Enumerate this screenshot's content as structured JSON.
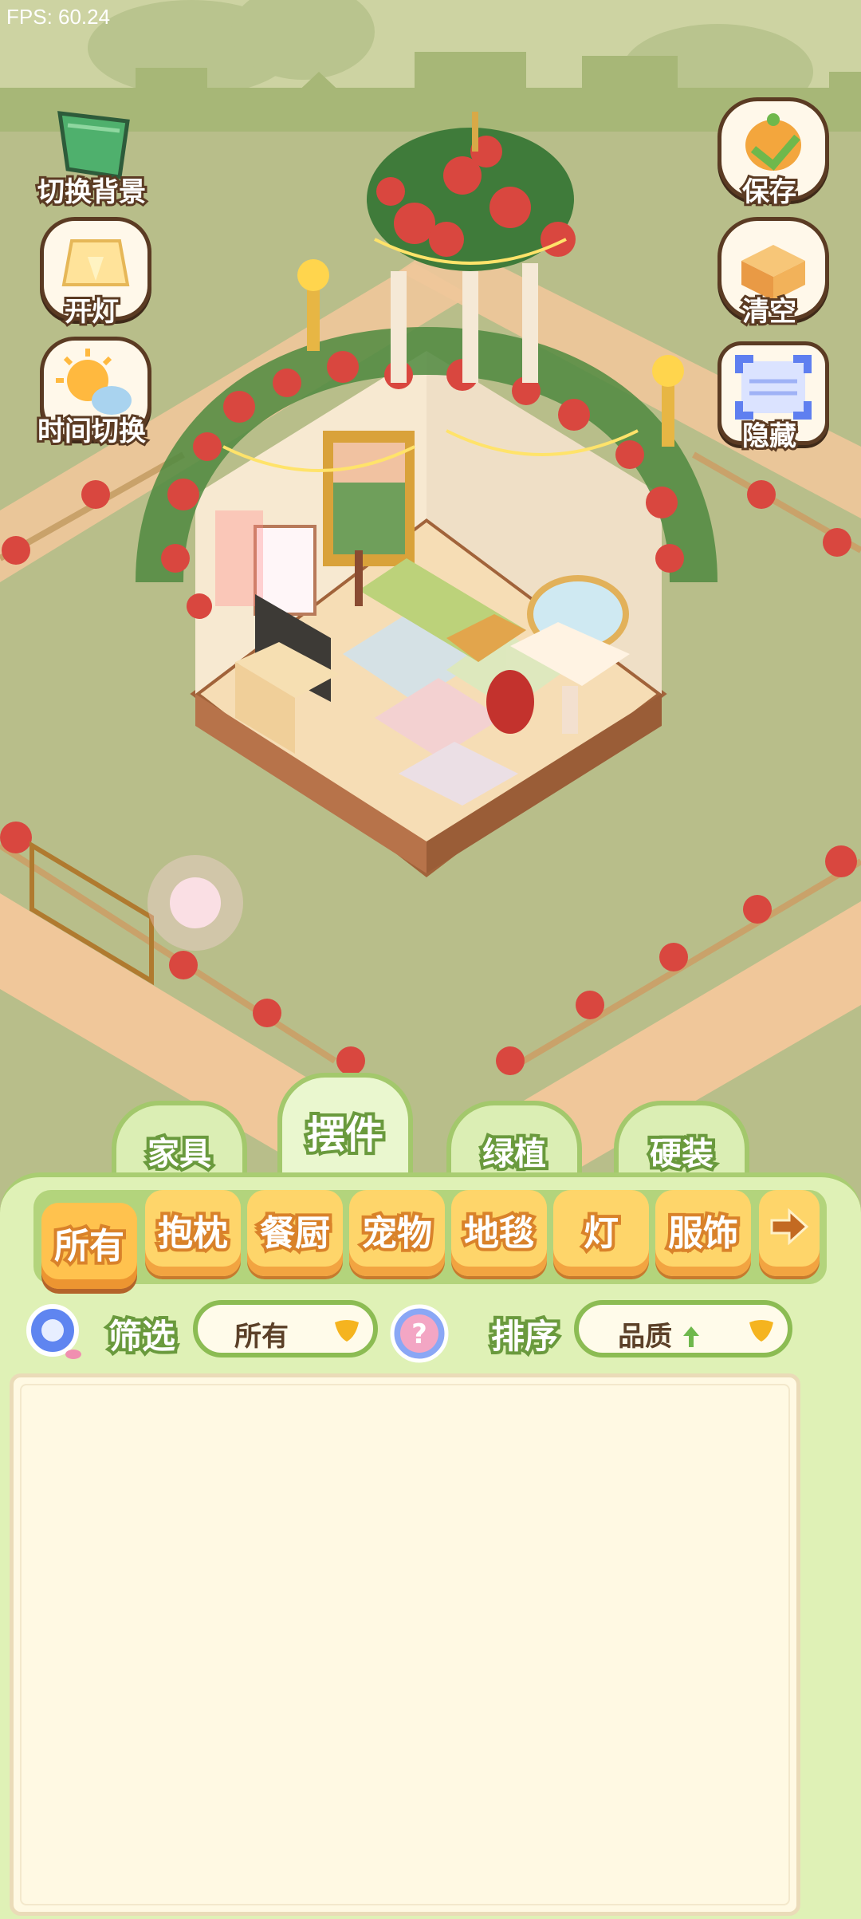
{
  "fps": "FPS: 60.24",
  "left_buttons": [
    {
      "label": "切换背景",
      "icon": "carpet-icon"
    },
    {
      "label": "开灯",
      "icon": "lamp-icon"
    },
    {
      "label": "时间切换",
      "icon": "sun-moon-icon"
    }
  ],
  "right_buttons": [
    {
      "label": "保存",
      "icon": "bird-save-icon"
    },
    {
      "label": "清空",
      "icon": "box-clear-icon"
    },
    {
      "label": "隐藏",
      "icon": "hide-frame-icon"
    }
  ],
  "tabs": [
    "家具",
    "摆件",
    "绿植",
    "硬装"
  ],
  "active_tab": "摆件",
  "categories": [
    "所有",
    "抱枕",
    "餐厨",
    "宠物",
    "地毯",
    "灯",
    "服饰"
  ],
  "active_category": "所有",
  "filter": {
    "label": "筛选",
    "value": "所有"
  },
  "sort": {
    "label": "排序",
    "value": "品质"
  },
  "colors": {
    "panel": "#dff1b6",
    "tab_border": "#a3c86c",
    "category": "#fed56a",
    "accent_green": "#6a9a3d"
  }
}
